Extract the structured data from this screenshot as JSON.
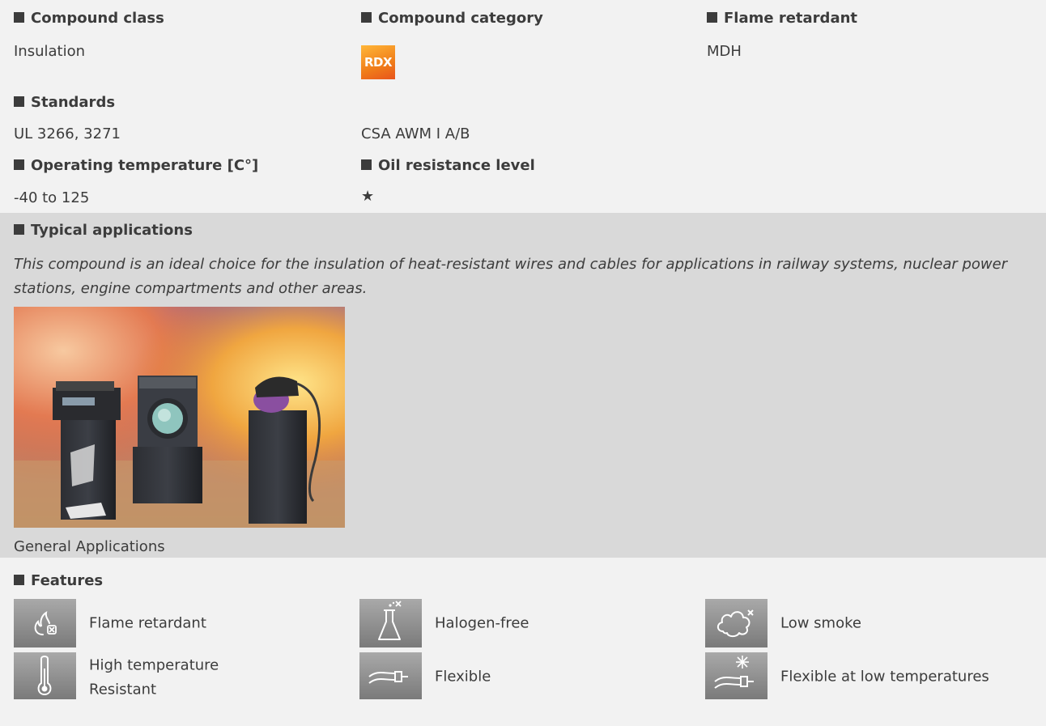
{
  "compound_class": {
    "label": "Compound class",
    "value": "Insulation"
  },
  "compound_category": {
    "label": "Compound category",
    "badge": "RDX",
    "badge_colors": [
      "#ffb638",
      "#e8541c"
    ]
  },
  "flame_retardant": {
    "label": "Flame retardant",
    "value": "MDH"
  },
  "standards": {
    "label": "Standards",
    "values": [
      "UL 3266, 3271",
      "CSA AWM I A/B"
    ]
  },
  "operating_temperature": {
    "label": "Operating temperature [C°]",
    "value": "-40 to 125"
  },
  "oil_resistance": {
    "label": "Oil resistance level",
    "value": "★"
  },
  "typical_applications": {
    "label": "Typical applications",
    "description": "This compound is an ideal choice for the insulation of heat-resistant wires and cables for applications in railway systems, nuclear power stations, engine compartments and other areas.",
    "image_caption": "General Applications"
  },
  "features": {
    "label": "Features",
    "items": [
      {
        "icon": "flame-retardant-icon",
        "label": "Flame retardant"
      },
      {
        "icon": "halogen-free-icon",
        "label": "Halogen-free"
      },
      {
        "icon": "low-smoke-icon",
        "label": "Low smoke"
      },
      {
        "icon": "thermometer-icon",
        "label_line1": "High temperature",
        "label_line2": "Resistant"
      },
      {
        "icon": "flexible-cable-icon",
        "label": "Flexible"
      },
      {
        "icon": "flexible-cold-icon",
        "label": "Flexible at low temperatures"
      }
    ]
  },
  "colors": {
    "page_bg": "#f2f2f2",
    "band_bg": "#d9d9d9",
    "text": "#3c3c3c",
    "icon_bg": "#8f8f8f"
  }
}
